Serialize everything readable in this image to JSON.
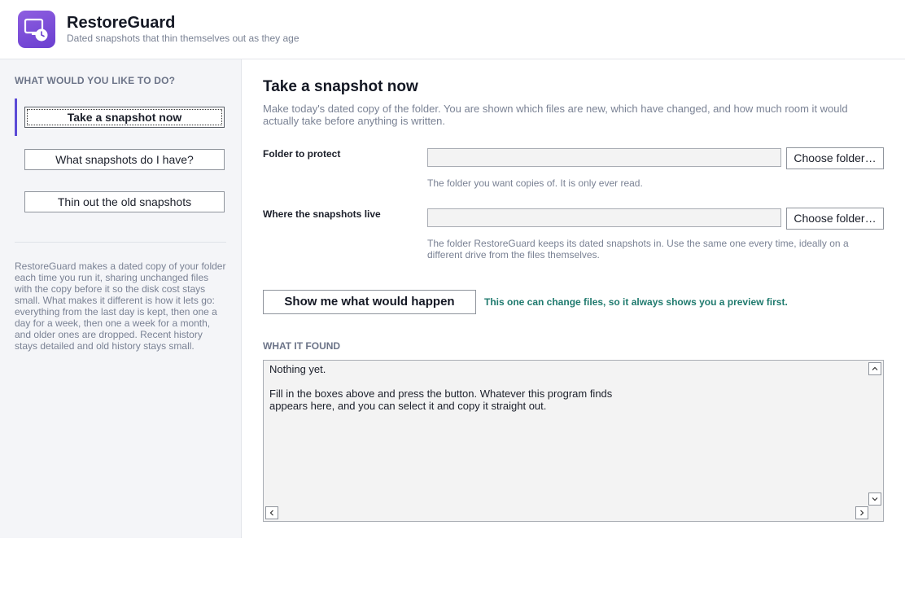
{
  "app": {
    "title": "RestoreGuard",
    "subtitle": "Dated snapshots that thin themselves out as they age",
    "logo_icon": "monitor-clock-icon",
    "brand_color": "#7b4fd8"
  },
  "sidebar": {
    "heading": "WHAT WOULD YOU LIKE TO DO?",
    "items": [
      {
        "label": "Take a snapshot now",
        "active": true
      },
      {
        "label": "What snapshots do I have?",
        "active": false
      },
      {
        "label": "Thin out the old snapshots",
        "active": false
      }
    ],
    "description": "RestoreGuard makes a dated copy of your folder each time you run it, sharing unchanged files with the copy before it so the disk cost stays small. What makes it different is how it lets go: everything from the last day is kept, then one a day for a week, then one a week for a month, and older ones are dropped. Recent history stays detailed and old history stays small."
  },
  "main": {
    "title": "Take a snapshot now",
    "description": "Make today's dated copy of the folder. You are shown which files are new, which have changed, and how much room it would actually take before anything is written.",
    "fields": [
      {
        "label": "Folder to protect",
        "value": "",
        "button": "Choose folder…",
        "hint": "The folder you want copies of. It is only ever read."
      },
      {
        "label": "Where the snapshots live",
        "value": "",
        "button": "Choose folder…",
        "hint": "The folder RestoreGuard keeps its dated snapshots in. Use the same one every time, ideally on a different drive from the files themselves."
      }
    ],
    "run_button": "Show me what would happen",
    "preview_note": "This one can change files, so it always shows you a preview first.",
    "accent_color": "#1f7a6e",
    "output_heading": "WHAT IT FOUND",
    "output_text": "Nothing yet.\n\nFill in the boxes above and press the button. Whatever this program finds\nappears here, and you can select it and copy it straight out."
  }
}
